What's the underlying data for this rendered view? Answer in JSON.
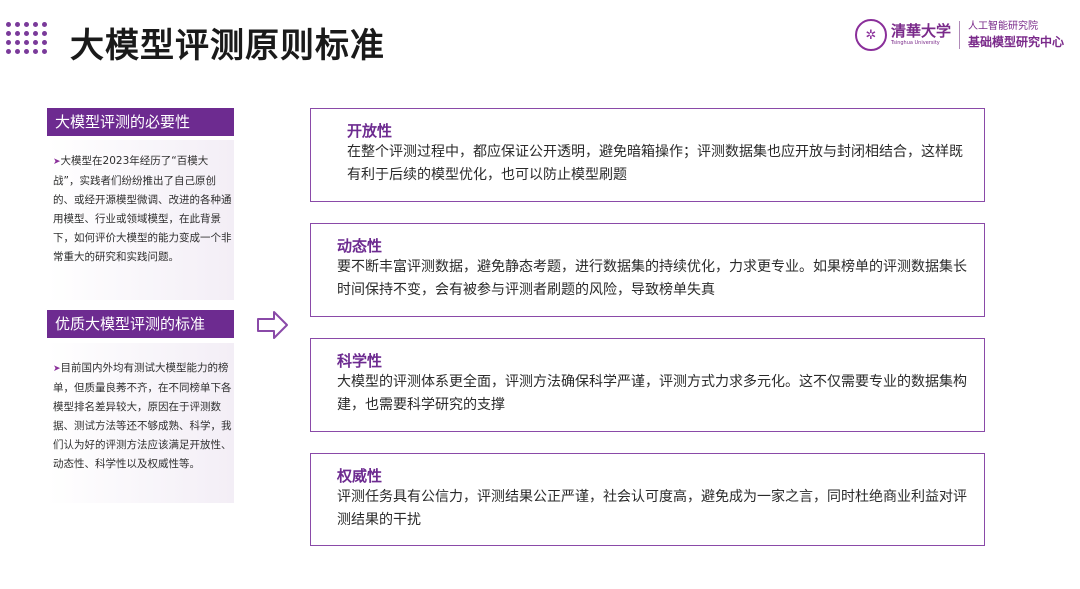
{
  "header": {
    "title": "大模型评测原则标准",
    "university_cn": "清華大学",
    "university_en": "Tsinghua University",
    "institute_line1": "人工智能研究院",
    "institute_line2": "基础模型研究中心",
    "brand_color": "#6d2b90"
  },
  "sidebar": {
    "sections": [
      {
        "title": "大模型评测的必要性",
        "text": "大模型在2023年经历了“百模大战”，实践者们纷纷推出了自己原创的、或经开源模型微调、改进的各种通用模型、行业或领域模型，在此背景下，如何评价大模型的能力变成一个非常重大的研究和实践问题。"
      },
      {
        "title": "优质大模型评测的标准",
        "text": "目前国内外均有测试大模型能力的榜单，但质量良莠不齐，在不同榜单下各模型排名差异较大，原因在于评测数据、测试方法等还不够成熟、科学，我们认为好的评测方法应该满足开放性、动态性、科学性以及权威性等。"
      }
    ]
  },
  "principles": [
    {
      "title": "开放性",
      "text": "在整个评测过程中，都应保证公开透明，避免暗箱操作；评测数据集也应开放与封闭相结合，这样既有利于后续的模型优化，也可以防止模型刷题"
    },
    {
      "title": "动态性",
      "text": "要不断丰富评测数据，避免静态考题，进行数据集的持续优化，力求更专业。如果榜单的评测数据集长时间保持不变，会有被参与评测者刷题的风险，导致榜单失真"
    },
    {
      "title": "科学性",
      "text": "大模型的评测体系更全面，评测方法确保科学严谨，评测方式力求多元化。这不仅需要专业的数据集构建，也需要科学研究的支撑"
    },
    {
      "title": "权威性",
      "text": "评测任务具有公信力，评测结果公正严谨，社会认可度高，避免成为一家之言，同时杜绝商业利益对评测结果的干扰"
    }
  ]
}
